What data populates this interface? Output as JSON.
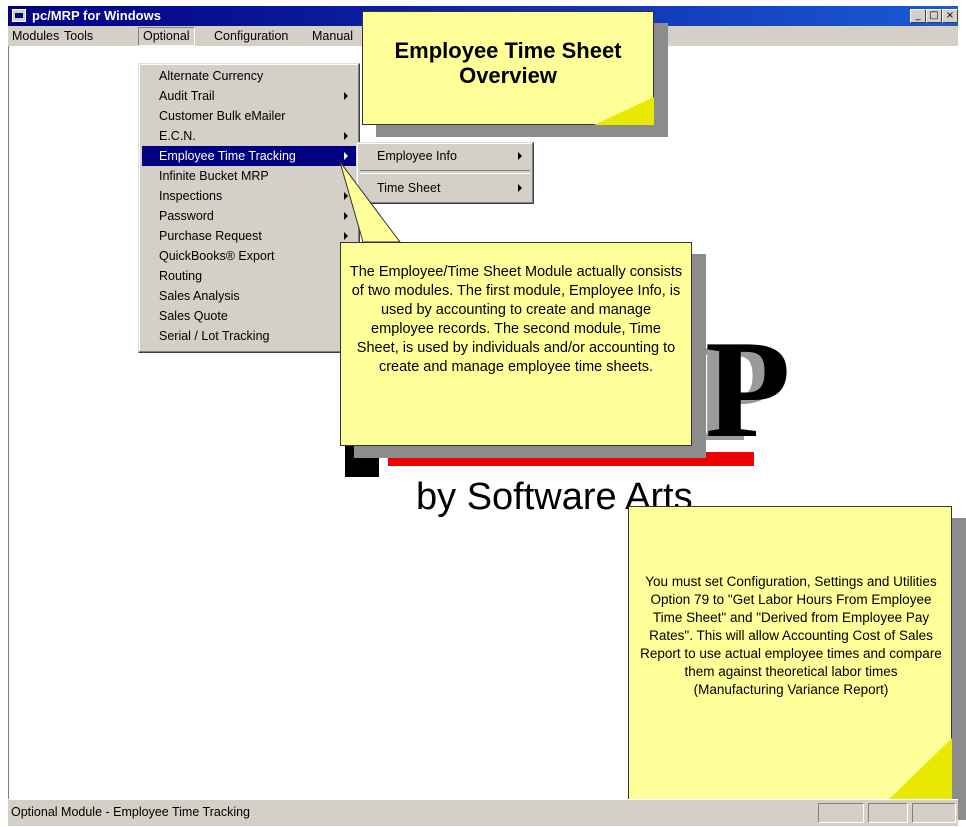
{
  "window": {
    "title": "pc/MRP for Windows",
    "buttons": [
      "_",
      "□",
      "×"
    ]
  },
  "menubar": {
    "items": [
      "Modules",
      "Tools",
      "Optional",
      "Configuration",
      "Manual"
    ],
    "active": "Optional"
  },
  "optional_menu": {
    "items": [
      {
        "label": "Alternate Currency",
        "submenu": false
      },
      {
        "label": "Audit Trail",
        "submenu": true
      },
      {
        "label": "Customer Bulk eMailer",
        "submenu": false
      },
      {
        "label": "E.C.N.",
        "submenu": true
      },
      {
        "label": "Employee Time Tracking",
        "submenu": true,
        "highlighted": true
      },
      {
        "label": "Infinite Bucket MRP",
        "submenu": false
      },
      {
        "label": "Inspections",
        "submenu": true
      },
      {
        "label": "Password",
        "submenu": true
      },
      {
        "label": "Purchase Request",
        "submenu": true
      },
      {
        "label": "QuickBooks® Export",
        "submenu": false
      },
      {
        "label": "Routing",
        "submenu": false
      },
      {
        "label": "Sales Analysis",
        "submenu": false
      },
      {
        "label": "Sales Quote",
        "submenu": false
      },
      {
        "label": "Serial / Lot Tracking",
        "submenu": false
      }
    ]
  },
  "submenu": {
    "items": [
      "Employee Info",
      "Time Sheet"
    ]
  },
  "logo": {
    "letter": "P",
    "tagline": "by Software Arts"
  },
  "notes": {
    "title": "Employee Time Sheet Overview",
    "modules": "The Employee/Time Sheet Module actually consists of two modules. The first module, Employee Info, is used by accounting to create and manage employee records. The second module, Time Sheet, is used by individuals and/or accounting to create and manage employee time sheets.",
    "config": "You must set Configuration, Settings and Utilities Option 79 to \"Get Labor Hours From Employee Time Sheet\" and \"Derived from Employee Pay Rates\".  This will allow Accounting Cost of Sales Report to use actual employee times and compare them against theoretical labor times (Manufacturing Variance Report)"
  },
  "status": {
    "text": "Optional Module - Employee Time Tracking"
  },
  "colors": {
    "titlebar": "#000080",
    "highlight": "#000080",
    "note": "#ffff99",
    "logo_bar": "#ee0000",
    "chrome": "#d4d0c8"
  }
}
